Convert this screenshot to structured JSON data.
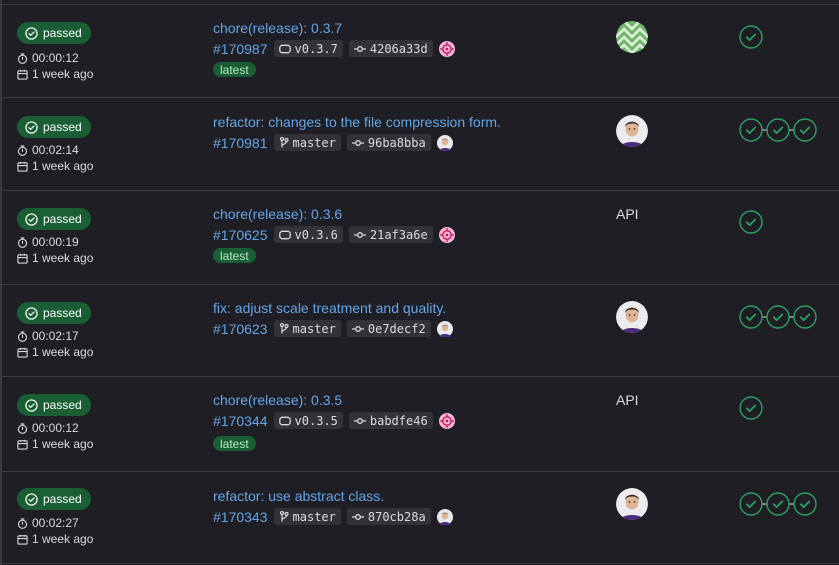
{
  "colors": {
    "passed": "#1a5f33",
    "link": "#63a6e9",
    "stage_ok": "#2da160",
    "background": "#1f1e24"
  },
  "pipelines": [
    {
      "status": "passed",
      "duration": "00:00:12",
      "finished": "1 week ago",
      "commit_title": "chore(release): 0.3.7",
      "id": "#170987",
      "ref_type": "tag",
      "ref": "v0.3.7",
      "sha": "4206a33d",
      "badge": "latest",
      "trigger": "avatar-pattern",
      "stages": 1
    },
    {
      "status": "passed",
      "duration": "00:02:14",
      "finished": "1 week ago",
      "commit_title": "refactor: changes to the file compression form.",
      "id": "#170981",
      "ref_type": "branch",
      "ref": "master",
      "sha": "96ba8bba",
      "badge": "",
      "trigger": "avatar-person",
      "stages": 3
    },
    {
      "status": "passed",
      "duration": "00:00:19",
      "finished": "1 week ago",
      "commit_title": "chore(release): 0.3.6",
      "id": "#170625",
      "ref_type": "tag",
      "ref": "v0.3.6",
      "sha": "21af3a6e",
      "badge": "latest",
      "trigger": "API",
      "stages": 1
    },
    {
      "status": "passed",
      "duration": "00:02:17",
      "finished": "1 week ago",
      "commit_title": "fix: adjust scale treatment and quality.",
      "id": "#170623",
      "ref_type": "branch",
      "ref": "master",
      "sha": "0e7decf2",
      "badge": "",
      "trigger": "avatar-person",
      "stages": 3
    },
    {
      "status": "passed",
      "duration": "00:00:12",
      "finished": "1 week ago",
      "commit_title": "chore(release): 0.3.5",
      "id": "#170344",
      "ref_type": "tag",
      "ref": "v0.3.5",
      "sha": "babdfe46",
      "badge": "latest",
      "trigger": "API",
      "stages": 1
    },
    {
      "status": "passed",
      "duration": "00:02:27",
      "finished": "1 week ago",
      "commit_title": "refactor: use abstract class.",
      "id": "#170343",
      "ref_type": "branch",
      "ref": "master",
      "sha": "870cb28a",
      "badge": "",
      "trigger": "avatar-person",
      "stages": 3
    }
  ]
}
